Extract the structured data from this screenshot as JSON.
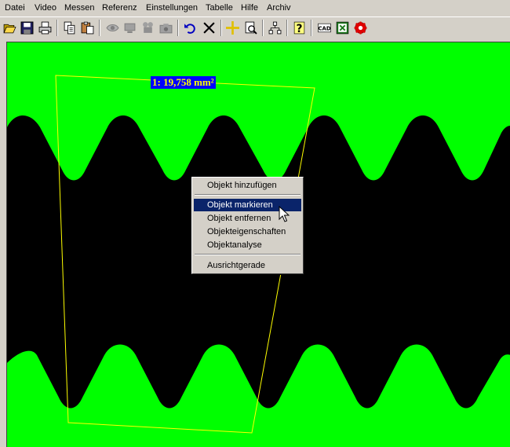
{
  "menubar": {
    "items": [
      "Datei",
      "Video",
      "Messen",
      "Referenz",
      "Einstellungen",
      "Tabelle",
      "Hilfe",
      "Archiv"
    ]
  },
  "toolbar": {
    "buttons": [
      {
        "icon": "open-folder-icon"
      },
      {
        "icon": "save-disk-icon"
      },
      {
        "icon": "print-icon"
      },
      {
        "icon": "copy-icon"
      },
      {
        "icon": "paste-icon"
      },
      {
        "icon": "eye-icon"
      },
      {
        "icon": "monitor-icon"
      },
      {
        "icon": "video-camera-icon"
      },
      {
        "icon": "photo-camera-icon"
      },
      {
        "icon": "undo-icon"
      },
      {
        "icon": "delete-x-icon"
      },
      {
        "icon": "crosshair-icon"
      },
      {
        "icon": "page-zoom-icon"
      },
      {
        "icon": "tree-network-icon"
      },
      {
        "icon": "help-question-icon"
      },
      {
        "icon": "cad-export-icon",
        "label": "CAD"
      },
      {
        "icon": "excel-export-icon"
      },
      {
        "icon": "settings-gear-red-icon"
      }
    ]
  },
  "measurement": {
    "label": "1: 19,758 mm²"
  },
  "context_menu": {
    "items": [
      {
        "label": "Objekt hinzufügen",
        "selected": false
      },
      {
        "label": "Objekt markieren",
        "selected": true
      },
      {
        "label": "Objekt entfernen",
        "selected": false
      },
      {
        "label": "Objekteigenschaften",
        "selected": false
      },
      {
        "label": "Objektanalyse",
        "selected": false
      },
      {
        "label": "Ausrichtgerade",
        "selected": false
      }
    ]
  },
  "colors": {
    "background_green": "#00ff00",
    "object_black": "#000000",
    "selection_outline": "#ffff00",
    "label_bg": "#0000ff",
    "label_text": "#ffff00",
    "menu_highlight": "#0a246a"
  }
}
